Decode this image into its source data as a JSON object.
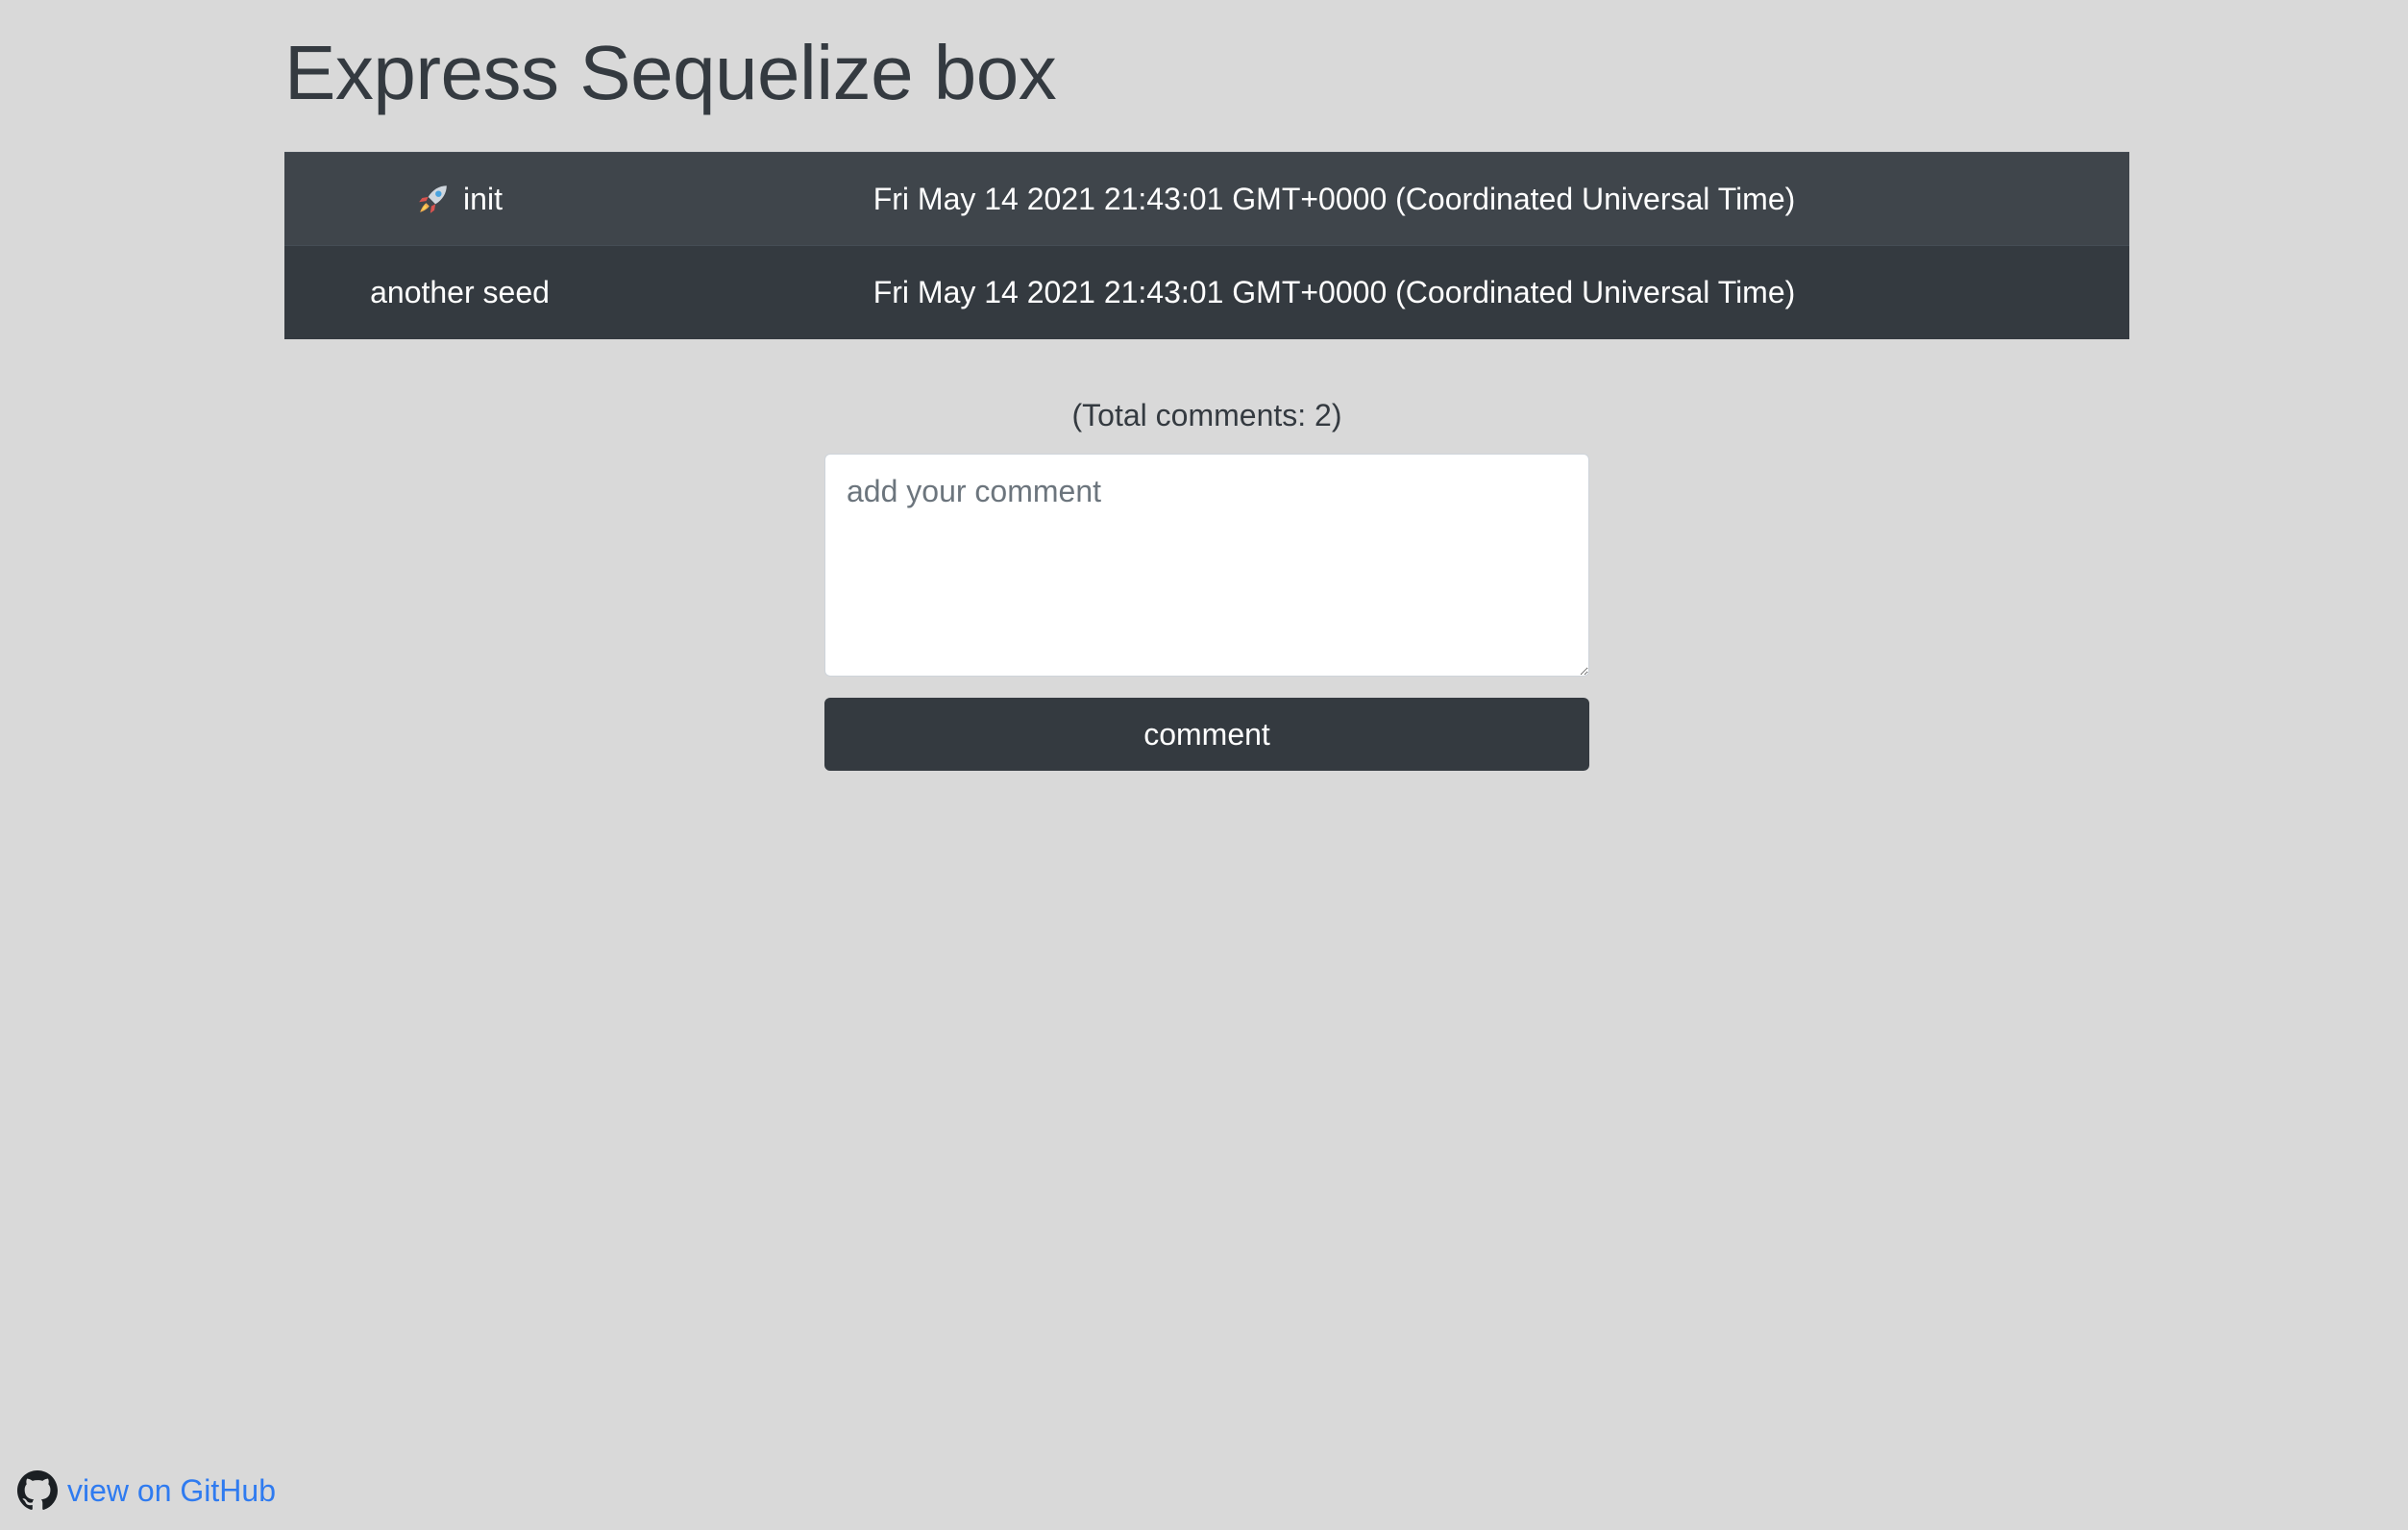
{
  "page": {
    "title": "Express Sequelize box"
  },
  "comments": [
    {
      "icon": "rocket-icon",
      "message": "init",
      "date": "Fri May 14 2021 21:43:01 GMT+0000 (Coordinated Universal Time)"
    },
    {
      "icon": null,
      "message": "another seed",
      "date": "Fri May 14 2021 21:43:01 GMT+0000 (Coordinated Universal Time)"
    }
  ],
  "summary": {
    "total_text": "(Total comments: 2)"
  },
  "form": {
    "placeholder": "add your comment",
    "value": "",
    "submit_label": "comment"
  },
  "footer": {
    "github_icon": "github-icon",
    "github_label": "view on GitHub"
  },
  "colors": {
    "background": "#d9d9d9",
    "table_row_odd": "#3f454b",
    "table_row_even": "#343a40",
    "button": "#343a40",
    "link": "#2f7bf0"
  }
}
